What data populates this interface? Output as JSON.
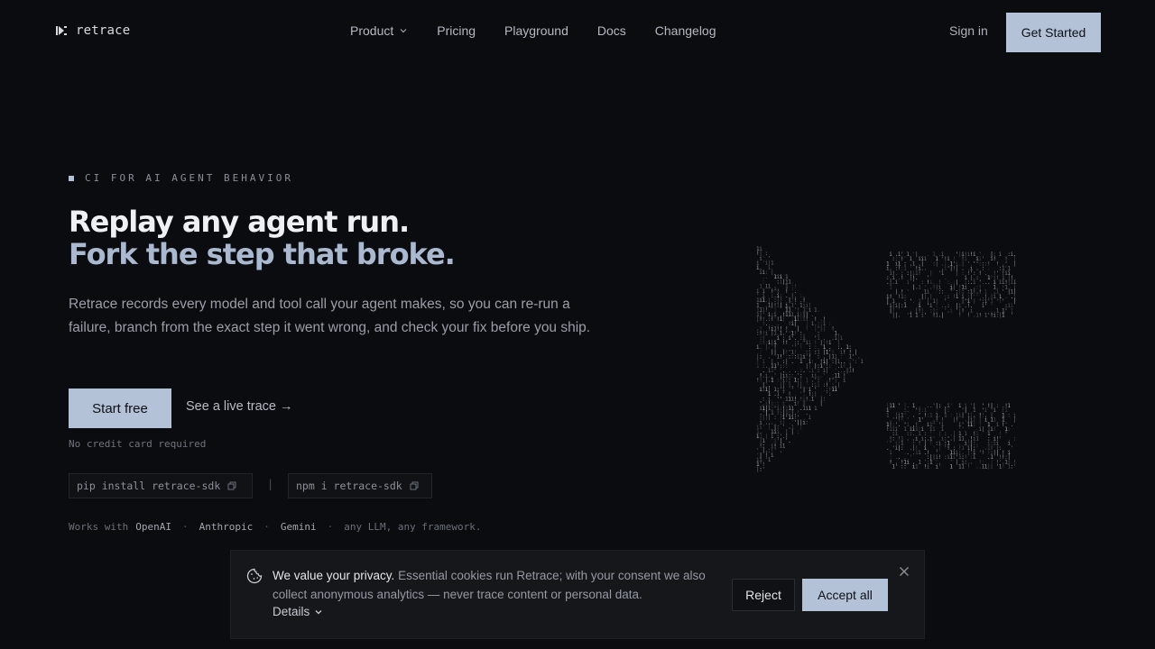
{
  "nav": {
    "logo_text": "retrace",
    "links": [
      "Product",
      "Pricing",
      "Playground",
      "Docs",
      "Changelog"
    ],
    "signin": "Sign in",
    "cta": "Get Started"
  },
  "hero": {
    "eyebrow": "CI FOR AI AGENT BEHAVIOR",
    "title_line1": "Replay any agent run.",
    "title_line2": "Fork the step that broke.",
    "lede": "Retrace records every model and tool call your agent makes, so you can re-run a failure, branch from the exact step it went wrong, and check your fix before you ship.",
    "primary_cta": "Start free",
    "secondary_cta": "See a live trace →",
    "note": "No credit card required",
    "install_pip": "pip install retrace-sdk",
    "install_npm": "npm i retrace-sdk",
    "separator": "|",
    "works_with_label": "Works with",
    "works_with": [
      "OpenAI",
      "Anthropic",
      "Gemini"
    ],
    "works_with_suffix": "any LLM, any framework."
  },
  "cookie": {
    "title": "We value your privacy.",
    "body": " Essential cookies run Retrace; with your consent we also collect anonymous analytics — never trace content or personal data.",
    "details": "Details",
    "reject": "Reject",
    "accept": "Accept all"
  },
  "colors": {
    "background": "#0b0c0f",
    "accent": "#b3c2d6",
    "heading": "#eef0f3",
    "heading_accent": "#aab9cf"
  }
}
